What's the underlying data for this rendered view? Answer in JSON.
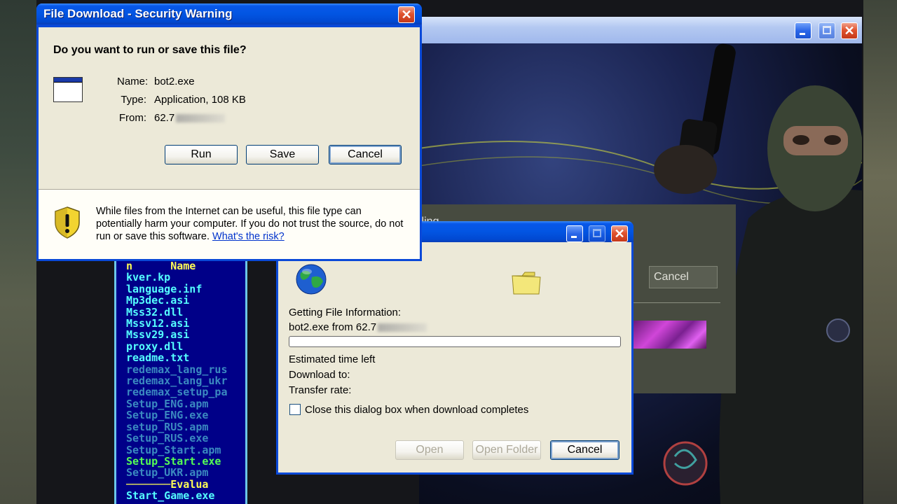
{
  "security_dialog": {
    "title": "File Download - Security Warning",
    "question": "Do you want to run or save this file?",
    "name_label": "Name:",
    "name_value": "bot2.exe",
    "type_label": "Type:",
    "type_value": "Application, 108 KB",
    "from_label": "From:",
    "from_value": "62.7",
    "buttons": {
      "run": "Run",
      "save": "Save",
      "cancel": "Cancel"
    },
    "warning_line1": "While files from the Internet can be useful, this file type can",
    "warning_line2": "potentially harm your computer. If you do not trust the source, do not",
    "warning_line3_prefix": "run or save this software.",
    "risk_link": "What's the risk?"
  },
  "download_dialog": {
    "status_label": "Getting File Information:",
    "source": "bot2.exe from 62.7",
    "progress": 0,
    "estimated_time_label": "Estimated time left",
    "download_to_label": "Download to:",
    "transfer_rate_label": "Transfer rate:",
    "close_checkbox_label": "Close this dialog box when download completes",
    "close_checkbox_checked": false,
    "buttons": {
      "open": "Open",
      "open_folder": "Open Folder",
      "cancel": "Cancel"
    }
  },
  "installer": {
    "status_fragment": "lling...",
    "cancel_label": "Cancel"
  },
  "file_list": {
    "header_left": "n",
    "header_right": "Name",
    "files": [
      {
        "name": "kver.kp",
        "style": "bright"
      },
      {
        "name": "language.inf",
        "style": "bright"
      },
      {
        "name": "Mp3dec.asi",
        "style": "bright"
      },
      {
        "name": "Mss32.dll",
        "style": "bright"
      },
      {
        "name": "Mssv12.asi",
        "style": "bright"
      },
      {
        "name": "Mssv29.asi",
        "style": "bright"
      },
      {
        "name": "proxy.dll",
        "style": "bright"
      },
      {
        "name": "readme.txt",
        "style": "bright"
      },
      {
        "name": "redemax_lang_rus",
        "style": "dim"
      },
      {
        "name": "redemax_lang_ukr",
        "style": "dim"
      },
      {
        "name": "redemax_setup_pa",
        "style": "dim"
      },
      {
        "name": "Setup_ENG.apm",
        "style": "dim"
      },
      {
        "name": "Setup_ENG.exe",
        "style": "dim"
      },
      {
        "name": "setup_RUS.apm",
        "style": "dim"
      },
      {
        "name": "Setup_RUS.exe",
        "style": "dim"
      },
      {
        "name": "Setup_Start.apm",
        "style": "dim"
      },
      {
        "name": "Setup_Start.exe",
        "style": "green"
      },
      {
        "name": "Setup_UKR.apm",
        "style": "dim"
      }
    ],
    "footer_label": "Evalua",
    "last_file": "Start_Game.exe"
  },
  "colors": {
    "xp_title": "#0255e2",
    "dialog_bg": "#ece9d8",
    "list_bg": "#000088"
  }
}
